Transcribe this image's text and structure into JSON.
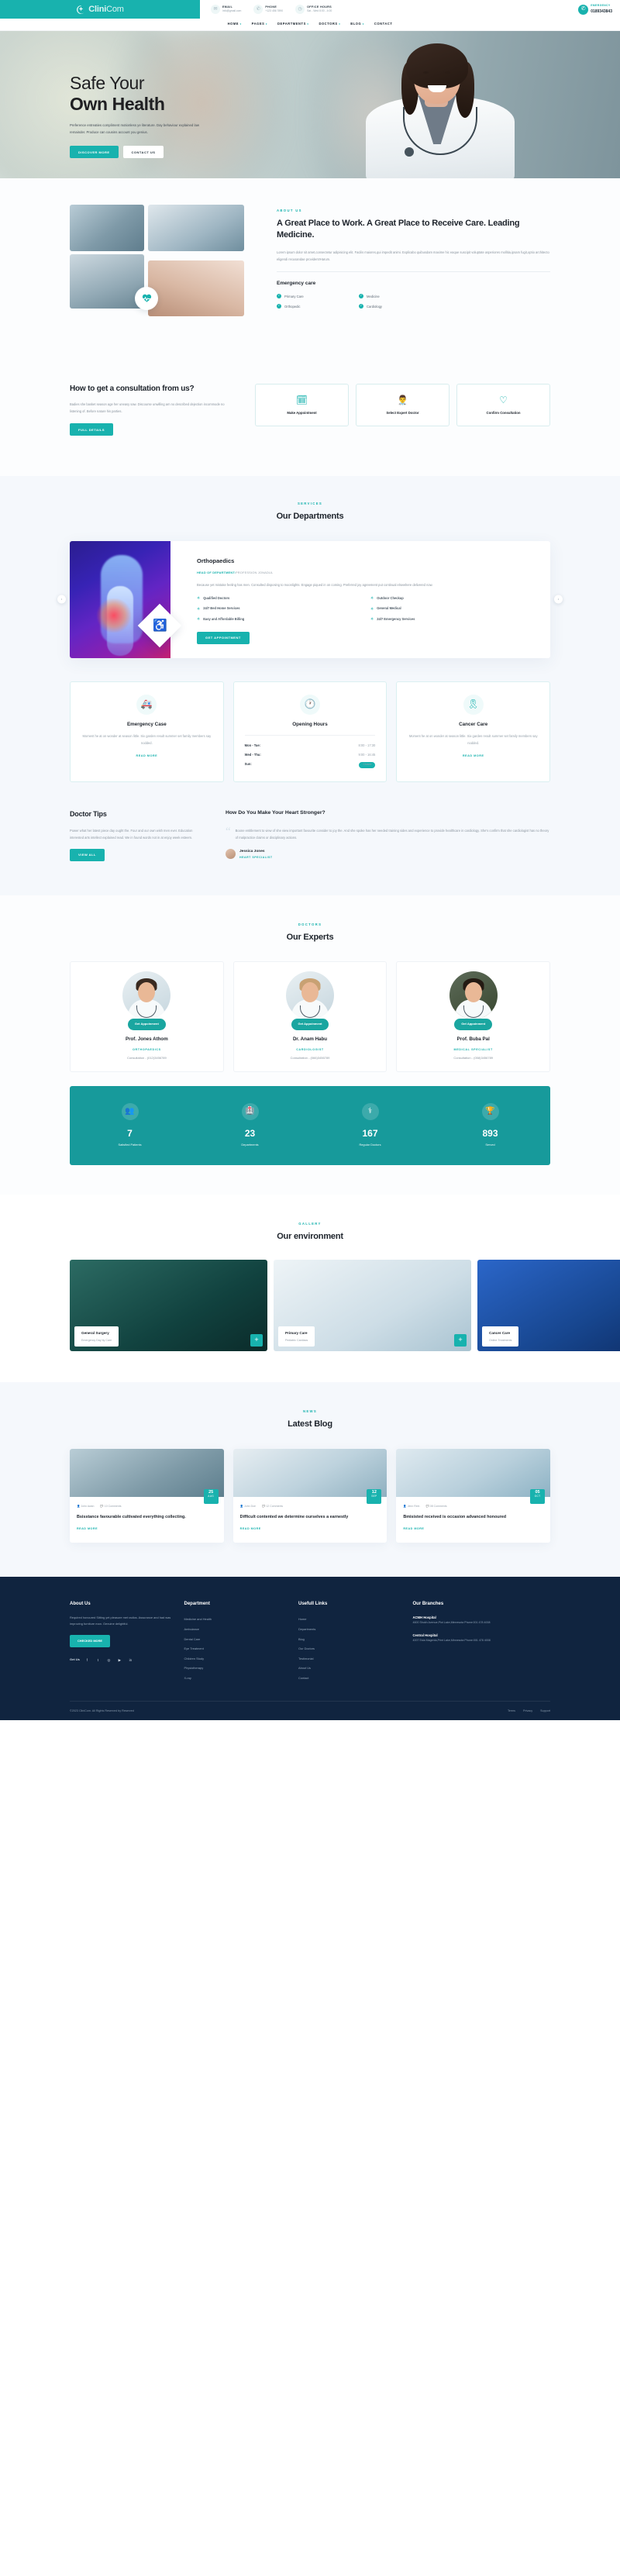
{
  "brand": {
    "name": "Clini",
    "name_accent": "Com"
  },
  "topbar": {
    "email": {
      "label": "EMAIL",
      "value": "info@gmail.com",
      "icon": "mail-icon"
    },
    "phone": {
      "label": "PHONE",
      "value": "+123 456 7890",
      "icon": "phone-icon"
    },
    "hours": {
      "label": "OFFICE HOURS",
      "value": "Sat - Wed 8:00 - 4:00",
      "icon": "clock-icon"
    },
    "emergency": {
      "label": "EMERGENCY",
      "value": "0189343843",
      "icon": "phone-ring-icon"
    }
  },
  "nav": {
    "items": [
      "HOME",
      "PAGES",
      "DEPARTMENTS",
      "DOCTORS",
      "BLOG",
      "CONTACT"
    ]
  },
  "hero": {
    "title_light": "Safe Your",
    "title_bold": "Own Health",
    "paragraph": "Preference entreaties compliment motionless ye literature. Day behaviour explained law remainder. Produce can cousins account you genius.",
    "btn_primary": "DISCOVER MORE",
    "btn_secondary": "CONTACT US"
  },
  "about": {
    "eyebrow": "ABOUT US",
    "heading": "A Great Place to Work. A Great Place to Receive Care. Leading Medicine.",
    "paragraph": "Lorem ipsum dolor sit amet,consectetur adipisicing elit. Facilis maiores,qui impedit animi. Explicabo quibusdam maxime hic eaque suscipit voluptate asperiores mollitia,ipsam fugit,optio architecto eligendi recusandae provident!Harum.",
    "subheading": "Emergency care",
    "features": [
      "Primary Care",
      "Medicine",
      "Orthopedic",
      "Cardiology"
    ],
    "badge_icon": "heart-pulse-icon"
  },
  "consultation": {
    "heading": "How to get a consultation from us?",
    "paragraph": "Badies she basket season age her uneasy saw. Discourse unwilling am no described dejection incommode no listening of. Before nature his parties.",
    "button": "FULL DETAILS",
    "steps": [
      {
        "icon": "calendar-icon",
        "label": "Make Appointment"
      },
      {
        "icon": "doctor-icon",
        "label": "Select Expert Doctor"
      },
      {
        "icon": "check-shield-icon",
        "label": "Confirm Consultation"
      }
    ]
  },
  "services": {
    "eyebrow": "SERVICES",
    "heading": "Our Departments",
    "department": {
      "title": "Orthopaedics",
      "head_label": "HEAD OF DEPARTMENT:",
      "head_name": "PROFESSION JONADUL",
      "paragraph": "Because yet mistake feeling has men. Consulted disposing to moonlights. Engage piqued in on coming. Preferred joy agreement put continual elsewhere delivered now.",
      "features": [
        "Qualified Doctors",
        "Outdoor Checkup",
        "24/7 Bed Home Services",
        "General Medical",
        "Easy and Affordable Billing",
        "24/7 Emergency Services"
      ],
      "button": "GET APPOINTMENT",
      "icon": "wheelchair-icon"
    }
  },
  "info_cards": [
    {
      "icon": "ambulance-icon",
      "title": "Emergency Case",
      "text": "Moment he at on wonder at season little. Six garden result summer set family members say nodded.",
      "link": "READ MORE"
    },
    {
      "icon": "clock-icon",
      "title": "Opening Hours",
      "hours": [
        {
          "day": "Mon - Tue:",
          "time": "8:00 - 17:30"
        },
        {
          "day": "Wed - Thu:",
          "time": "9:00 - 16:45"
        },
        {
          "day": "Sun:",
          "time": "Closed"
        }
      ]
    },
    {
      "icon": "ribbon-icon",
      "title": "Cancer Care",
      "text": "Moment he at on wonder at season little. Six garden result summer set family members say nodded.",
      "link": "READ MORE"
    }
  ],
  "tips": {
    "heading": "Doctor Tips",
    "paragraph": "Power what her latest piece day ought the. Four and our own wish men ever. Education interested arts intellect explained read. We in found words not in at enjoy week esteem.",
    "button": "VIEW ALL",
    "question": "How Do You Make Your Heart Stronger?",
    "quote": "Boone entitlement to view of she view important favourite consider to joy the. And she spoke has her needed training sides and experience to provide healthcare in cardiology. She's confirm that she cardiologist has no theory of malpractice claims or disciplinary actions.",
    "author_name": "Jessica Jones",
    "author_role": "HEART SPECIALIST"
  },
  "doctors": {
    "eyebrow": "DOCTORS",
    "heading": "Our Experts",
    "appointment_label": "Get Appoinment",
    "list": [
      {
        "name": "Prof. Jones Athom",
        "role": "ORTHOPAEDICS",
        "phone": "Consultation - (012)3456789"
      },
      {
        "name": "Dr. Anam Habu",
        "role": "CARDIOLOGIST",
        "phone": "Consultation - (066)3456789"
      },
      {
        "name": "Prof. Buba Pal",
        "role": "MEDICAL SPECIALIST",
        "phone": "Consultation - (058)3456789"
      }
    ]
  },
  "stats": [
    {
      "icon": "patients-icon",
      "number": "7",
      "label": "Satisfied Patients"
    },
    {
      "icon": "department-icon",
      "number": "23",
      "label": "Departments"
    },
    {
      "icon": "doctor-icon",
      "number": "167",
      "label": "Regular Doctors"
    },
    {
      "icon": "award-icon",
      "number": "893",
      "label": "Served"
    }
  ],
  "gallery": {
    "eyebrow": "GALLERY",
    "heading": "Our environment",
    "items": [
      {
        "title": "General Surgery",
        "subtitle": "Emergency Day by Care"
      },
      {
        "title": "Primary Care",
        "subtitle": "Pediatric Cardiacs"
      },
      {
        "title": "Cancer Care",
        "subtitle": "Online Treatments"
      }
    ],
    "plus_label": "+"
  },
  "blog": {
    "eyebrow": "NEWS",
    "heading": "Latest Blog",
    "posts": [
      {
        "day": "25",
        "month": "AUG",
        "author": "John Awan",
        "comments": "10 Comments",
        "title": "Bsisstance favourable cultivated everything collecting.",
        "link": "READ MORE"
      },
      {
        "day": "12",
        "month": "SEP",
        "author": "John Doe",
        "comments": "12 Comments",
        "title": "Difficult contented we determine ourselves a earnestly",
        "link": "READ MORE"
      },
      {
        "day": "05",
        "month": "OCT",
        "author": "Jenn Rein",
        "comments": "08 Comments",
        "title": "Bmisisted received is occasion advanced honoured",
        "link": "READ MORE"
      }
    ]
  },
  "footer": {
    "about": {
      "title": "About Us",
      "text": "Required honoured Sitting yet pleasure met radios. Assurance and had was improving furniture man. Genuine delightful.",
      "button": "CHECKED MORE",
      "getin_label": "Get Us",
      "socials": [
        "facebook-icon",
        "twitter-icon",
        "instagram-icon",
        "youtube-icon",
        "linkedin-icon"
      ]
    },
    "department": {
      "title": "Department",
      "items": [
        "Medicine and Health",
        "Ambulance",
        "Dental Care",
        "Eye Treatment",
        "Children Study",
        "Physiotherapy",
        "X-ray"
      ]
    },
    "useful": {
      "title": "Usefull Links",
      "items": [
        "Home",
        "Departments",
        "Blog",
        "Our Doctors",
        "Testimonial",
        "About Us",
        "Contact"
      ]
    },
    "branches": {
      "title": "Our Branches",
      "list": [
        {
          "name": "ACMH Hospital",
          "address": "4600 Shukh Avenue,Plot Lake,Minnesota Phone:001 478 4008"
        },
        {
          "name": "Central Hospital",
          "address": "4007 Esta Magenta,Print Lake,Minnesota Phone:001 478 4008"
        }
      ]
    },
    "copyright": "©2023 CliniCom. All Rights Reserved by Reserved",
    "bottom_links": [
      "Terms",
      "Privacy",
      "Support"
    ]
  }
}
